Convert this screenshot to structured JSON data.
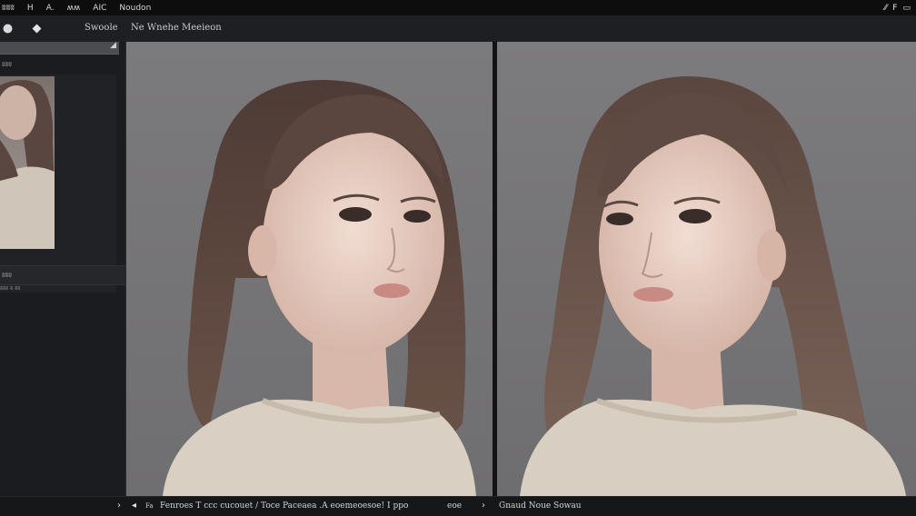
{
  "menubar": {
    "items": [
      "ʬʬʬ",
      "H",
      "A.",
      "ʍʍ",
      "AIC",
      "Noudon"
    ],
    "right_icons": [
      {
        "icon": "cursor-icon",
        "glyph": "⁄⁄"
      },
      {
        "icon": "text-icon",
        "glyph": "F"
      },
      {
        "icon": "window-icon",
        "glyph": "▭"
      }
    ]
  },
  "toolbar": {
    "left_icon": "circle-icon",
    "second_icon": "diamond-icon",
    "label_1": "Swoole",
    "label_2": "Ne Wnehe Meeieon"
  },
  "sidebar": {
    "header_label": "",
    "section_label": "ʬʬʬ",
    "thumb_caption": "ʬʬʬ ʬ ʬʬ",
    "bar_label": "ʬʬʬ"
  },
  "status": {
    "items": [
      {
        "icon": "chevron-right-icon",
        "glyph": "›"
      },
      {
        "icon": "play-back-icon",
        "glyph": "◂"
      }
    ],
    "text_1": "Fa",
    "text_2": "Fenroes T ccc cucouet / Toce Paceaea .A eoemeoesoe! I ppo",
    "text_3": "eoe",
    "text_4": "Gnaud Noue Sowau",
    "arrow": "›"
  },
  "colors": {
    "background": "#1a1b1d",
    "panel_gray": "#757476",
    "accent_skin": "#e6cfc4",
    "hair_brown": "#5e4a42",
    "sweater": "#d8cfc2"
  }
}
